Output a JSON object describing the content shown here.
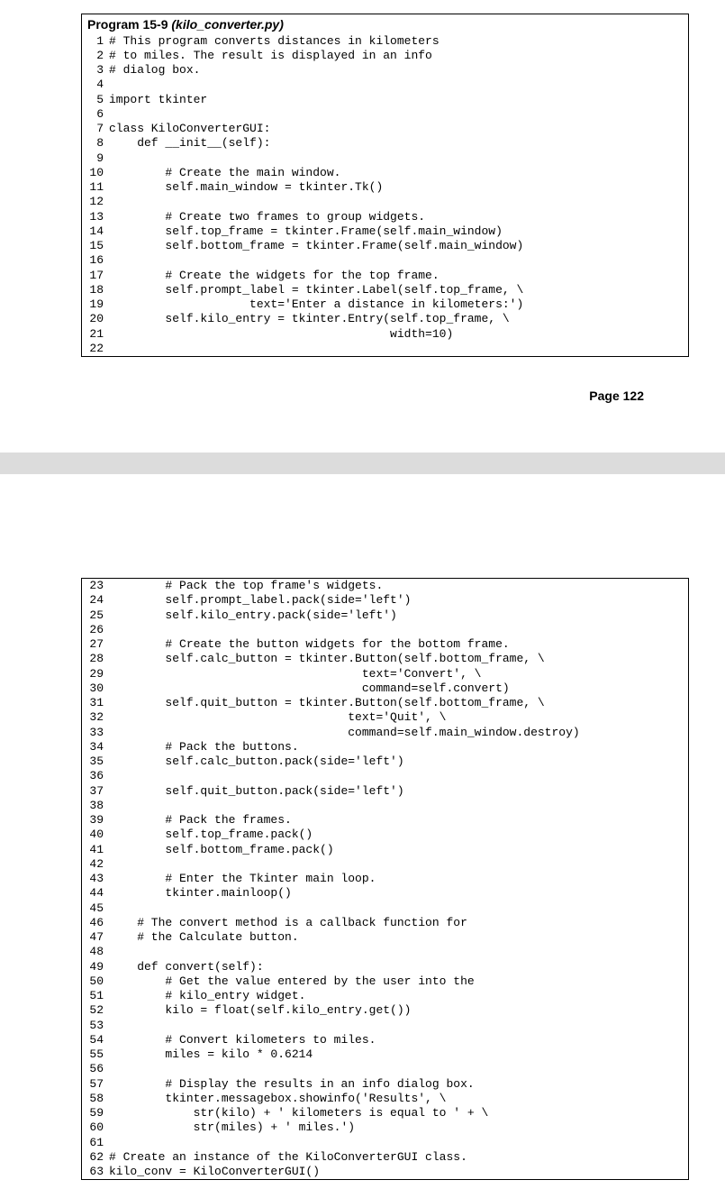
{
  "block1": {
    "program_label": "Program 15-9",
    "filename": "(kilo_converter.py)",
    "lines": [
      {
        "n": "1",
        "c": "# This program converts distances in kilometers"
      },
      {
        "n": "2",
        "c": "# to miles. The result is displayed in an info"
      },
      {
        "n": "3",
        "c": "# dialog box."
      },
      {
        "n": "4",
        "c": ""
      },
      {
        "n": "5",
        "c": "import tkinter"
      },
      {
        "n": "6",
        "c": ""
      },
      {
        "n": "7",
        "c": "class KiloConverterGUI:"
      },
      {
        "n": "8",
        "c": "    def __init__(self):"
      },
      {
        "n": "9",
        "c": ""
      },
      {
        "n": "10",
        "c": "        # Create the main window."
      },
      {
        "n": "11",
        "c": "        self.main_window = tkinter.Tk()"
      },
      {
        "n": "12",
        "c": ""
      },
      {
        "n": "13",
        "c": "        # Create two frames to group widgets."
      },
      {
        "n": "14",
        "c": "        self.top_frame = tkinter.Frame(self.main_window)"
      },
      {
        "n": "15",
        "c": "        self.bottom_frame = tkinter.Frame(self.main_window)"
      },
      {
        "n": "16",
        "c": ""
      },
      {
        "n": "17",
        "c": "        # Create the widgets for the top frame."
      },
      {
        "n": "18",
        "c": "        self.prompt_label = tkinter.Label(self.top_frame, \\"
      },
      {
        "n": "19",
        "c": "                    text='Enter a distance in kilometers:')"
      },
      {
        "n": "20",
        "c": "        self.kilo_entry = tkinter.Entry(self.top_frame, \\"
      },
      {
        "n": "21",
        "c": "                                        width=10)"
      },
      {
        "n": "22",
        "c": ""
      }
    ]
  },
  "page_number": "Page 122",
  "block2": {
    "lines": [
      {
        "n": "23",
        "c": "        # Pack the top frame's widgets."
      },
      {
        "n": "24",
        "c": "        self.prompt_label.pack(side='left')"
      },
      {
        "n": "25",
        "c": "        self.kilo_entry.pack(side='left')"
      },
      {
        "n": "26",
        "c": ""
      },
      {
        "n": "27",
        "c": "        # Create the button widgets for the bottom frame."
      },
      {
        "n": "28",
        "c": "        self.calc_button = tkinter.Button(self.bottom_frame, \\"
      },
      {
        "n": "29",
        "c": "                                    text='Convert', \\"
      },
      {
        "n": "30",
        "c": "                                    command=self.convert)"
      },
      {
        "n": "31",
        "c": "        self.quit_button = tkinter.Button(self.bottom_frame, \\"
      },
      {
        "n": "32",
        "c": "                                  text='Quit', \\"
      },
      {
        "n": "33",
        "c": "                                  command=self.main_window.destroy)"
      },
      {
        "n": "34",
        "c": "        # Pack the buttons."
      },
      {
        "n": "35",
        "c": "        self.calc_button.pack(side='left')"
      },
      {
        "n": "36",
        "c": ""
      },
      {
        "n": "37",
        "c": "        self.quit_button.pack(side='left')"
      },
      {
        "n": "38",
        "c": ""
      },
      {
        "n": "39",
        "c": "        # Pack the frames."
      },
      {
        "n": "40",
        "c": "        self.top_frame.pack()"
      },
      {
        "n": "41",
        "c": "        self.bottom_frame.pack()"
      },
      {
        "n": "42",
        "c": ""
      },
      {
        "n": "43",
        "c": "        # Enter the Tkinter main loop."
      },
      {
        "n": "44",
        "c": "        tkinter.mainloop()"
      },
      {
        "n": "45",
        "c": ""
      },
      {
        "n": "46",
        "c": "    # The convert method is a callback function for"
      },
      {
        "n": "47",
        "c": "    # the Calculate button."
      },
      {
        "n": "48",
        "c": ""
      },
      {
        "n": "49",
        "c": "    def convert(self):"
      },
      {
        "n": "50",
        "c": "        # Get the value entered by the user into the"
      },
      {
        "n": "51",
        "c": "        # kilo_entry widget."
      },
      {
        "n": "52",
        "c": "        kilo = float(self.kilo_entry.get())"
      },
      {
        "n": "53",
        "c": ""
      },
      {
        "n": "54",
        "c": "        # Convert kilometers to miles."
      },
      {
        "n": "55",
        "c": "        miles = kilo * 0.6214"
      },
      {
        "n": "56",
        "c": ""
      },
      {
        "n": "57",
        "c": "        # Display the results in an info dialog box."
      },
      {
        "n": "58",
        "c": "        tkinter.messagebox.showinfo('Results', \\"
      },
      {
        "n": "59",
        "c": "            str(kilo) + ' kilometers is equal to ' + \\"
      },
      {
        "n": "60",
        "c": "            str(miles) + ' miles.')"
      },
      {
        "n": "61",
        "c": ""
      },
      {
        "n": "62",
        "c": "# Create an instance of the KiloConverterGUI class."
      },
      {
        "n": "63",
        "c": "kilo_conv = KiloConverterGUI()"
      }
    ]
  }
}
